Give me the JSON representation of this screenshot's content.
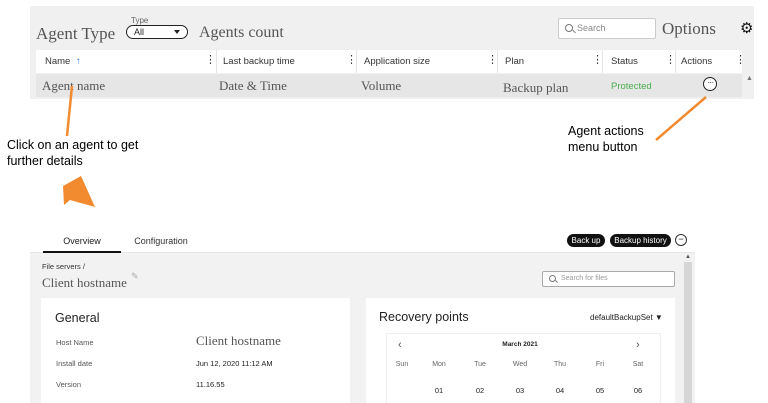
{
  "top_panel": {
    "agent_type_label": "Agent Type",
    "type_filter": {
      "caption": "Type",
      "value": "All"
    },
    "agents_count_label": "Agents count",
    "search": {
      "placeholder": "Search"
    },
    "options_label": "Options",
    "columns": [
      "Name",
      "Last backup time",
      "Application size",
      "Plan",
      "Status",
      "Actions"
    ],
    "sort_indicator": "↑",
    "row": {
      "name": "Agent name",
      "last_backup": "Date & Time",
      "app_size": "Volume",
      "plan": "Backup plan",
      "status": "Protected"
    },
    "actions_glyph": "···"
  },
  "annotations": {
    "left": "Click on an agent to get further details",
    "right": "Agent actions menu button"
  },
  "colors": {
    "arrow": "#f28a30",
    "status_ok": "#4caf50"
  },
  "details_panel": {
    "tabs": [
      "Overview",
      "Configuration"
    ],
    "buttons": {
      "backup": "Back up",
      "history": "Backup history"
    },
    "breadcrumb": "File servers /",
    "client_title": "Client hostname",
    "files_search_placeholder": "Search for files",
    "general": {
      "title": "General",
      "host_name_label": "Host Name",
      "host_name_value": "Client hostname",
      "install_date_label": "Install date",
      "install_date_value": "Jun 12, 2020 11:12 AM",
      "version_label": "Version",
      "version_value": "11.16.55"
    },
    "recovery": {
      "title": "Recovery points",
      "backup_set": "defaultBackupSet ▼",
      "month": "March 2021",
      "weekdays": [
        "Sun",
        "Mon",
        "Tue",
        "Wed",
        "Thu",
        "Fri",
        "Sat"
      ],
      "days": [
        "01",
        "02",
        "03",
        "04",
        "05",
        "06"
      ]
    }
  }
}
